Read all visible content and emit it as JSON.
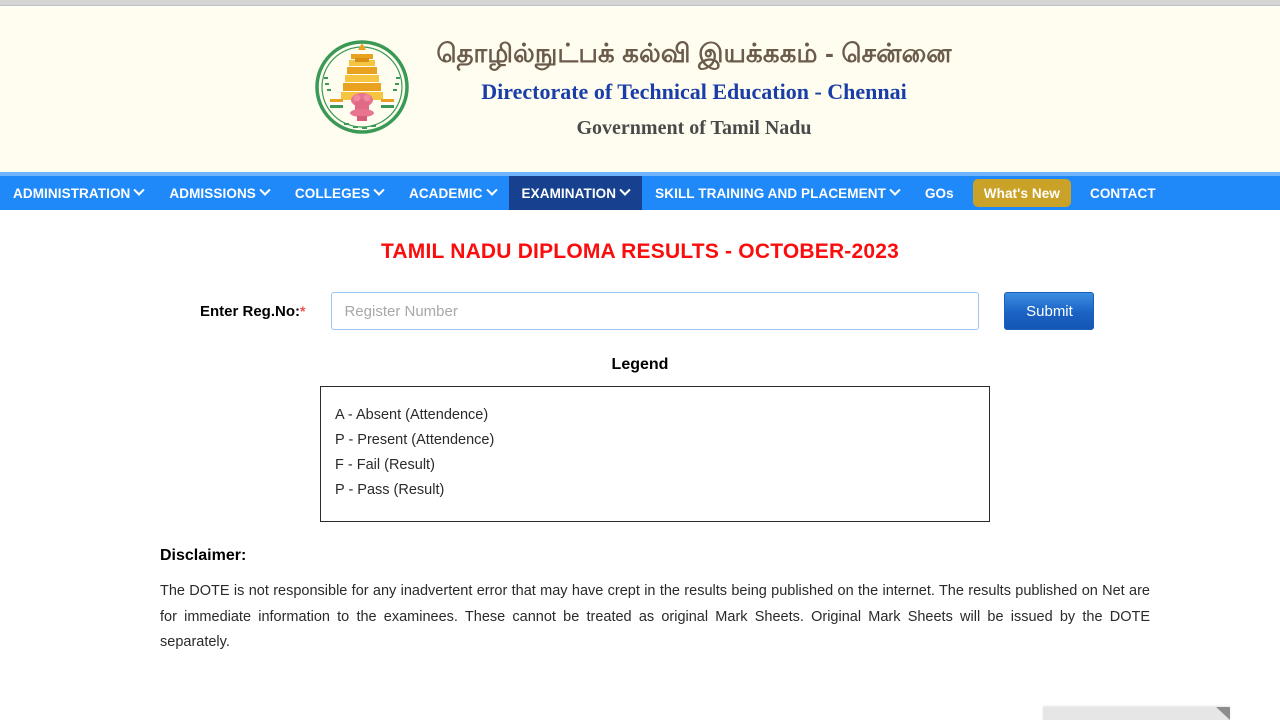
{
  "header": {
    "emblem_icon": "tamil-nadu-state-emblem-icon",
    "title_tamil": "தொழில்நுட்பக் கல்வி இயக்ககம் - சென்னை",
    "title_english": "Directorate of Technical Education - Chennai",
    "title_government": "Government of Tamil Nadu",
    "background_color": "#fffdf0",
    "tamil_color": "#6b5b4b",
    "english_color": "#1a3ea8"
  },
  "nav": {
    "background_color": "#2089f9",
    "active_color": "#17418f",
    "highlight_color": "#c9a227",
    "items": [
      {
        "label": "ADMINISTRATION",
        "has_caret": true,
        "state": "normal"
      },
      {
        "label": "ADMISSIONS",
        "has_caret": true,
        "state": "normal"
      },
      {
        "label": "COLLEGES",
        "has_caret": true,
        "state": "normal"
      },
      {
        "label": "ACADEMIC",
        "has_caret": true,
        "state": "normal"
      },
      {
        "label": "EXAMINATION",
        "has_caret": true,
        "state": "active"
      },
      {
        "label": "SKILL TRAINING AND PLACEMENT",
        "has_caret": true,
        "state": "normal"
      },
      {
        "label": "GOs",
        "has_caret": false,
        "state": "normal"
      },
      {
        "label": "What's New",
        "has_caret": false,
        "state": "highlight"
      },
      {
        "label": "CONTACT",
        "has_caret": false,
        "state": "normal"
      }
    ]
  },
  "main": {
    "results_title": "TAMIL NADU DIPLOMA RESULTS - OCTOBER-2023",
    "results_title_color": "#fb0d0d",
    "form": {
      "reg_label": "Enter Reg.No:",
      "required_marker": "*",
      "reg_placeholder": "Register Number",
      "reg_value": "",
      "submit_label": "Submit"
    },
    "legend": {
      "heading": "Legend",
      "lines": [
        "A - Absent (Attendence)",
        "P - Present (Attendence)",
        "F - Fail (Result)",
        "P - Pass (Result)"
      ]
    },
    "disclaimer": {
      "heading": "Disclaimer:",
      "body": "The DOTE is not responsible for any inadvertent error that may have crept in the results being published on the internet. The results published on Net are for immediate information to the examinees. These cannot be treated as original Mark Sheets. Original Mark Sheets will be issued by the DOTE separately."
    }
  }
}
